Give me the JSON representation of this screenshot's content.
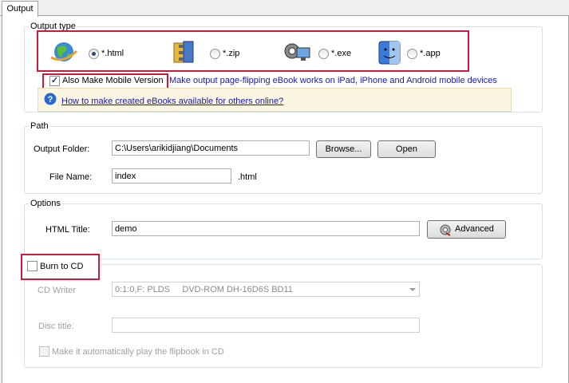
{
  "tab": {
    "label": "Output"
  },
  "output_type": {
    "title": "Output type",
    "options": [
      {
        "label": "*.html",
        "selected": true,
        "icon": "globe-icon"
      },
      {
        "label": "*.zip",
        "selected": false,
        "icon": "zip-archive-icon"
      },
      {
        "label": "*.exe",
        "selected": false,
        "icon": "gear-computer-icon"
      },
      {
        "label": "*.app",
        "selected": false,
        "icon": "mac-finder-icon"
      }
    ],
    "mobile_checkbox_label": "Also Make Mobile Version",
    "mobile_checkbox_checked": true,
    "mobile_description": "Make output page-flipping eBook works on iPad, iPhone and Android mobile devices",
    "help_link": "How to make created eBooks available for others online?"
  },
  "path": {
    "title": "Path",
    "output_folder_label": "Output Folder:",
    "output_folder_value": "C:\\Users\\arikidjiang\\Documents",
    "browse_label": "Browse...",
    "open_label": "Open",
    "file_name_label": "File Name:",
    "file_name_value": "index",
    "file_ext": ".html"
  },
  "options": {
    "title": "Options",
    "html_title_label": "HTML Title:",
    "html_title_value": "demo",
    "advanced_label": "Advanced"
  },
  "burn": {
    "checkbox_label": "Burn to CD",
    "checked": false,
    "cd_writer_label": "CD Writer",
    "cd_writer_value": "0:1:0,F: PLDS     DVD-ROM DH-16D6S BD11",
    "disc_title_label": "Disc title:",
    "disc_title_value": "",
    "autoplay_label": "Make it automatically play the flipbook in CD",
    "autoplay_checked": false
  },
  "colors": {
    "highlight_red": "#d0183c",
    "link_blue": "#1a1aa6"
  }
}
